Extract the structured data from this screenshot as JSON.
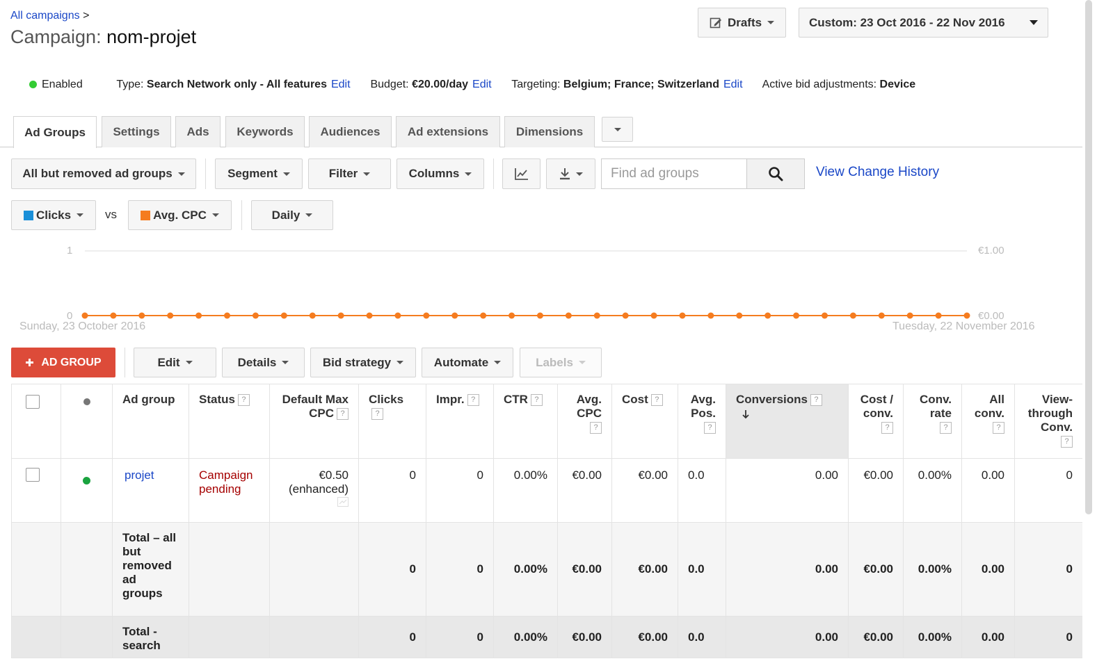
{
  "breadcrumb": {
    "link": "All campaigns",
    "sep": ">"
  },
  "title": {
    "prefix": "Campaign:",
    "name": "nom-projet"
  },
  "header": {
    "drafts_label": "Drafts",
    "date_range": "Custom: 23 Oct 2016 - 22 Nov 2016"
  },
  "campaign_status": {
    "status": "Enabled",
    "type_label": "Type:",
    "type_value": "Search Network only - All features",
    "budget_label": "Budget:",
    "budget_value": "€20.00/day",
    "targeting_label": "Targeting:",
    "targeting_value": "Belgium; France; Switzerland",
    "bid_label": "Active bid adjustments:",
    "bid_value": "Device",
    "edit": "Edit"
  },
  "tabs": [
    "Ad Groups",
    "Settings",
    "Ads",
    "Keywords",
    "Audiences",
    "Ad extensions",
    "Dimensions"
  ],
  "toolbar": {
    "filter_view": "All but removed ad groups",
    "segment": "Segment",
    "filter": "Filter",
    "columns": "Columns",
    "search_placeholder": "Find ad groups",
    "view_history": "View Change History"
  },
  "chart_controls": {
    "metric1": "Clicks",
    "vs": "vs",
    "metric2": "Avg. CPC",
    "interval": "Daily",
    "metric1_color": "#1a8fd8",
    "metric2_color": "#f57c1f"
  },
  "chart_data": {
    "type": "line",
    "x_start_label": "Sunday, 23 October 2016",
    "x_end_label": "Tuesday, 22 November 2016",
    "y_left_ticks": [
      "1",
      "0"
    ],
    "y_right_ticks": [
      "€1.00",
      "€0.00"
    ],
    "y_left_range": [
      0,
      1
    ],
    "y_right_range": [
      0,
      1
    ],
    "series": [
      {
        "name": "Clicks",
        "color": "#1a8fd8",
        "values": [
          0,
          0,
          0,
          0,
          0,
          0,
          0,
          0,
          0,
          0,
          0,
          0,
          0,
          0,
          0,
          0,
          0,
          0,
          0,
          0,
          0,
          0,
          0,
          0,
          0,
          0,
          0,
          0,
          0,
          0,
          0,
          0
        ]
      },
      {
        "name": "Avg. CPC",
        "color": "#f57c1f",
        "values": [
          0,
          0,
          0,
          0,
          0,
          0,
          0,
          0,
          0,
          0,
          0,
          0,
          0,
          0,
          0,
          0,
          0,
          0,
          0,
          0,
          0,
          0,
          0,
          0,
          0,
          0,
          0,
          0,
          0,
          0,
          0,
          0
        ]
      }
    ]
  },
  "actions": {
    "add": "AD GROUP",
    "edit": "Edit",
    "details": "Details",
    "bid_strategy": "Bid strategy",
    "automate": "Automate",
    "labels": "Labels"
  },
  "table": {
    "headers": {
      "ad_group": "Ad group",
      "status": "Status",
      "max_cpc": "Default Max CPC",
      "clicks": "Clicks",
      "impr": "Impr.",
      "ctr": "CTR",
      "avg_cpc": "Avg. CPC",
      "cost": "Cost",
      "avg_pos": "Avg. Pos.",
      "conversions": "Conversions",
      "cost_conv": "Cost / conv.",
      "conv_rate": "Conv. rate",
      "all_conv": "All conv.",
      "view_through": "View-through Conv.",
      "help": "?"
    },
    "row": {
      "name": "projet",
      "status": "Campaign pending",
      "max_cpc": "€0.50",
      "max_cpc_note": "(enhanced)",
      "clicks": "0",
      "impr": "0",
      "ctr": "0.00%",
      "avg_cpc": "€0.00",
      "cost": "€0.00",
      "avg_pos": "0.0",
      "conversions": "0.00",
      "cost_conv": "€0.00",
      "conv_rate": "0.00%",
      "all_conv": "0.00",
      "view_through": "0"
    },
    "total1": {
      "label": "Total – all but removed ad groups",
      "clicks": "0",
      "impr": "0",
      "ctr": "0.00%",
      "avg_cpc": "€0.00",
      "cost": "€0.00",
      "avg_pos": "0.0",
      "conversions": "0.00",
      "cost_conv": "€0.00",
      "conv_rate": "0.00%",
      "all_conv": "0.00",
      "view_through": "0"
    },
    "total2": {
      "label": "Total - search",
      "clicks": "0",
      "impr": "0",
      "ctr": "0.00%",
      "avg_cpc": "€0.00",
      "cost": "€0.00",
      "avg_pos": "0.0",
      "conversions": "0.00",
      "cost_conv": "€0.00",
      "conv_rate": "0.00%",
      "all_conv": "0.00",
      "view_through": "0"
    }
  }
}
